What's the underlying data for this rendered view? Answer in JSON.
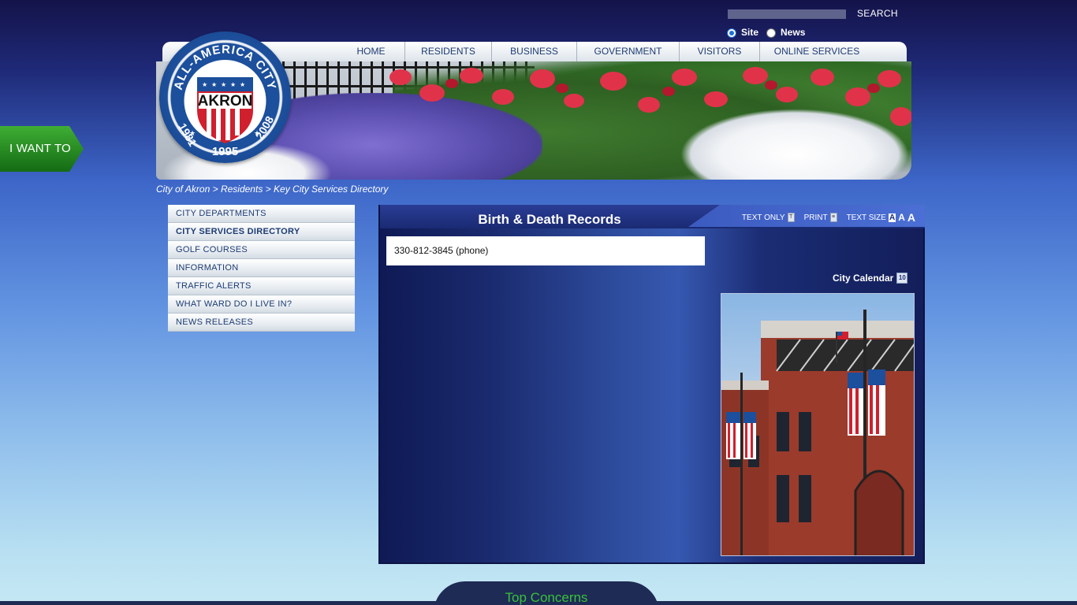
{
  "search": {
    "value": "",
    "button_label": "SEARCH",
    "scopes": [
      {
        "label": "Site",
        "selected": true
      },
      {
        "label": "News",
        "selected": false
      }
    ]
  },
  "nav": {
    "items": [
      {
        "label": "HOME"
      },
      {
        "label": "RESIDENTS"
      },
      {
        "label": "BUSINESS"
      },
      {
        "label": "GOVERNMENT"
      },
      {
        "label": "VISITORS"
      },
      {
        "label": "ONLINE SERVICES"
      }
    ]
  },
  "seal": {
    "top_text": "ALL-AMERICA CITY",
    "center_text": "AKRON",
    "year_left": "1981",
    "year_bottom": "1995",
    "year_right": "2008"
  },
  "i_want_to": {
    "label": "I WANT TO",
    "color": "#1f8a1f"
  },
  "breadcrumb": {
    "items": [
      "City of Akron",
      "Residents",
      "Key City Services Directory"
    ],
    "separator": ">"
  },
  "sidebar": {
    "items": [
      {
        "label": "CITY DEPARTMENTS",
        "active": false
      },
      {
        "label": "CITY SERVICES DIRECTORY",
        "active": true
      },
      {
        "label": "GOLF COURSES",
        "active": false
      },
      {
        "label": "INFORMATION",
        "active": false
      },
      {
        "label": "TRAFFIC ALERTS",
        "active": false
      },
      {
        "label": "WHAT WARD DO I LIVE IN?",
        "active": false
      },
      {
        "label": "NEWS RELEASES",
        "active": false
      }
    ]
  },
  "panel": {
    "title": "Birth & Death Records",
    "tools": {
      "text_only": "TEXT ONLY",
      "print": "PRINT",
      "text_size": "TEXT SIZE",
      "size_glyph": "A"
    },
    "content": "330-812-3845 (phone)",
    "calendar_label": "City Calendar",
    "calendar_icon_text": "10"
  },
  "footer": {
    "top_concerns": "Top Concerns",
    "accent": "#38c23a"
  },
  "colors": {
    "brand_navy": "#1d3b73",
    "panel_blue": "#1a2a73",
    "seal_blue": "#1c4f9c",
    "seal_red": "#d0202e"
  }
}
